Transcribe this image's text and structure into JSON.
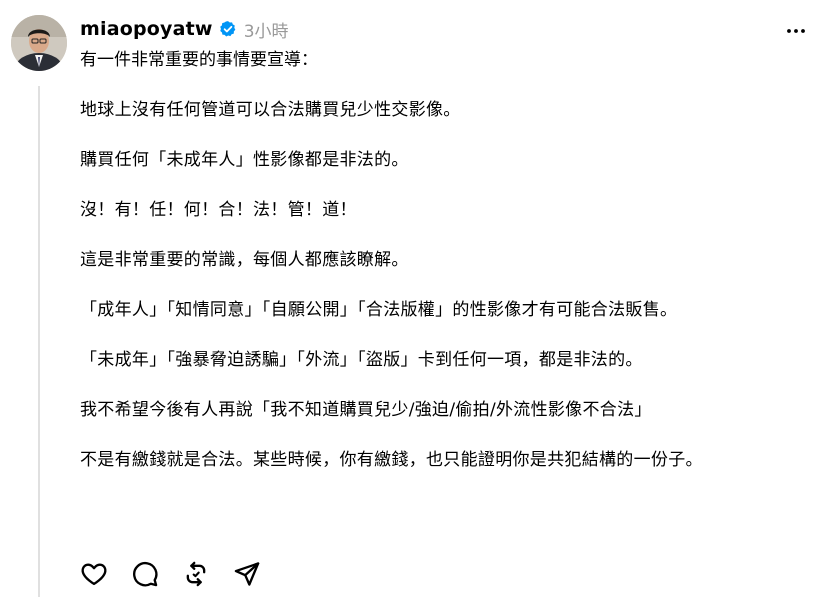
{
  "post": {
    "username": "miaopoyatw",
    "timestamp": "3小時",
    "intro": "有一件非常重要的事情要宣導：",
    "paragraphs": [
      "地球上沒有任何管道可以合法購買兒少性交影像。",
      "購買任何「未成年人」性影像都是非法的。",
      "沒！有！任！何！合！法！管！道！",
      "這是非常重要的常識，每個人都應該瞭解。",
      "「成年人」「知情同意」「自願公開」「合法版權」的性影像才有可能合法販售。",
      "「未成年」「強暴脅迫誘騙」「外流」「盜版」卡到任何一項，都是非法的。",
      "我不希望今後有人再說「我不知道購買兒少/強迫/偷拍/外流性影像不合法」",
      "不是有繳錢就是合法。某些時候，你有繳錢，也只能證明你是共犯結構的一份子。"
    ]
  },
  "icons": {
    "verified": "verified-badge-icon",
    "more": "more-options-icon",
    "like": "heart-icon",
    "comment": "comment-bubble-icon",
    "repost": "repost-icon",
    "share": "send-icon"
  },
  "colors": {
    "verified": "#0095f6",
    "timestamp": "#999999",
    "thread_line": "#e0e0e0"
  }
}
